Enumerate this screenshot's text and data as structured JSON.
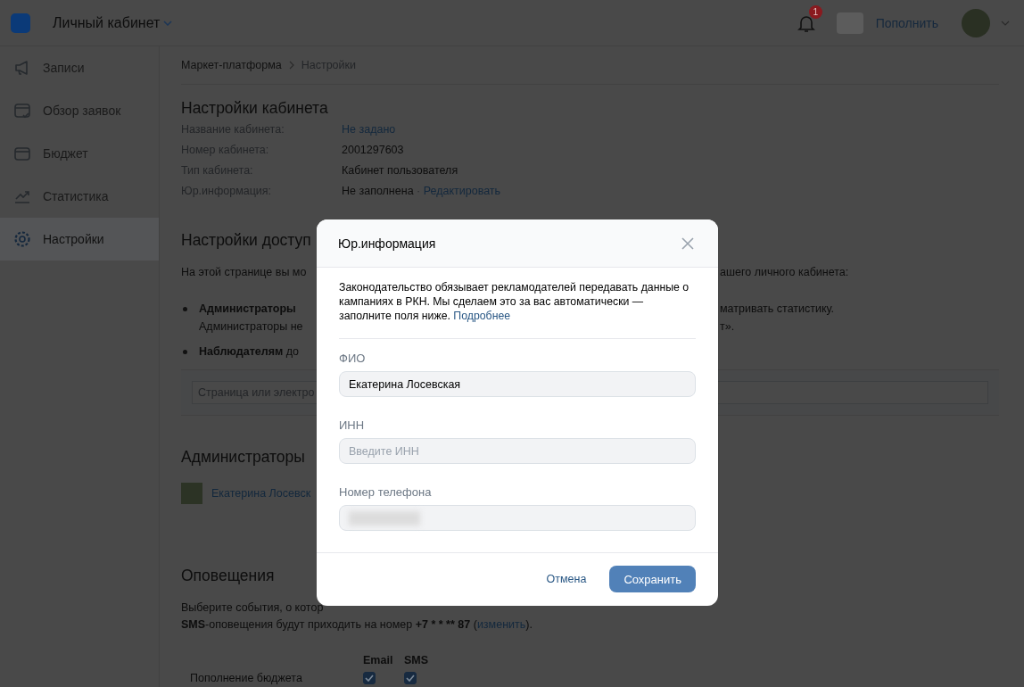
{
  "header": {
    "title": "Личный кабинет",
    "notification_badge": "1",
    "topup_button": "Пополнить"
  },
  "sidebar": {
    "items": [
      {
        "label": "Записи",
        "selected": false
      },
      {
        "label": "Обзор заявок",
        "selected": false
      },
      {
        "label": "Бюджет",
        "selected": false
      },
      {
        "label": "Статистика",
        "selected": false
      },
      {
        "label": "Настройки",
        "selected": true
      }
    ]
  },
  "breadcrumb": [
    "Маркет-платформа",
    "Настройки"
  ],
  "cabinet_settings": {
    "title": "Настройки кабинета",
    "rows": [
      {
        "label": "Название кабинета:",
        "value": "Не задано",
        "kind": "link"
      },
      {
        "label": "Номер кабинета:",
        "value": "2001297603",
        "kind": "text"
      },
      {
        "label": "Тип кабинета:",
        "value": "Кабинет пользователя",
        "kind": "text"
      },
      {
        "label": "Юр.информация:",
        "value": "Не заполнена",
        "kind": "text",
        "separator": "·",
        "link": "Редактировать"
      }
    ]
  },
  "access_settings": {
    "title": "Настройки доступ",
    "intro": {
      "left": "На этой странице вы мо",
      "right": "ашего личного кабинета:"
    },
    "bullets": [
      {
        "lines": [
          {
            "left": "**Администраторы**",
            "right": "матривать статистику."
          },
          {
            "left": "Администраторы не",
            "right": "т»."
          }
        ]
      },
      {
        "lines": [
          {
            "left": "**Наблюдателям** до"
          }
        ]
      }
    ],
    "search": {
      "placeholder": "Страница или электро"
    }
  },
  "administrators": {
    "title": "Администраторы",
    "items": [
      {
        "name": "Екатерина Лосевск"
      }
    ]
  },
  "notifications": {
    "title": "Оповещения",
    "intro": "Выберите события, о котор",
    "sms_note": "**SMS**-оповещения будут приходить на номер **+7 *** *** ** 87** (",
    "sms_link": "изменить",
    "sms_note_end": ").",
    "columns": [
      "Email",
      "SMS"
    ],
    "rows": [
      {
        "label": "Пополнение бюджета",
        "email": {
          "checked": true
        },
        "sms": {
          "checked": true
        }
      }
    ]
  },
  "dialog": {
    "title": "Юр.информация",
    "text": "Законодательство обязывает рекламодателей передавать данные о кампаниях в РКН. Мы сделаем это за вас автоматически — заполните поля ниже.",
    "more_link": "Подробнее",
    "fields": [
      {
        "label": "ФИО",
        "value": "Екатерина Лосевская",
        "kind": "text"
      },
      {
        "label": "ИНН",
        "placeholder": "Введите ИНН",
        "kind": "text"
      },
      {
        "label": "Номер телефона",
        "kind": "redacted"
      }
    ],
    "cancel": "Отмена",
    "save": "Сохранить"
  }
}
